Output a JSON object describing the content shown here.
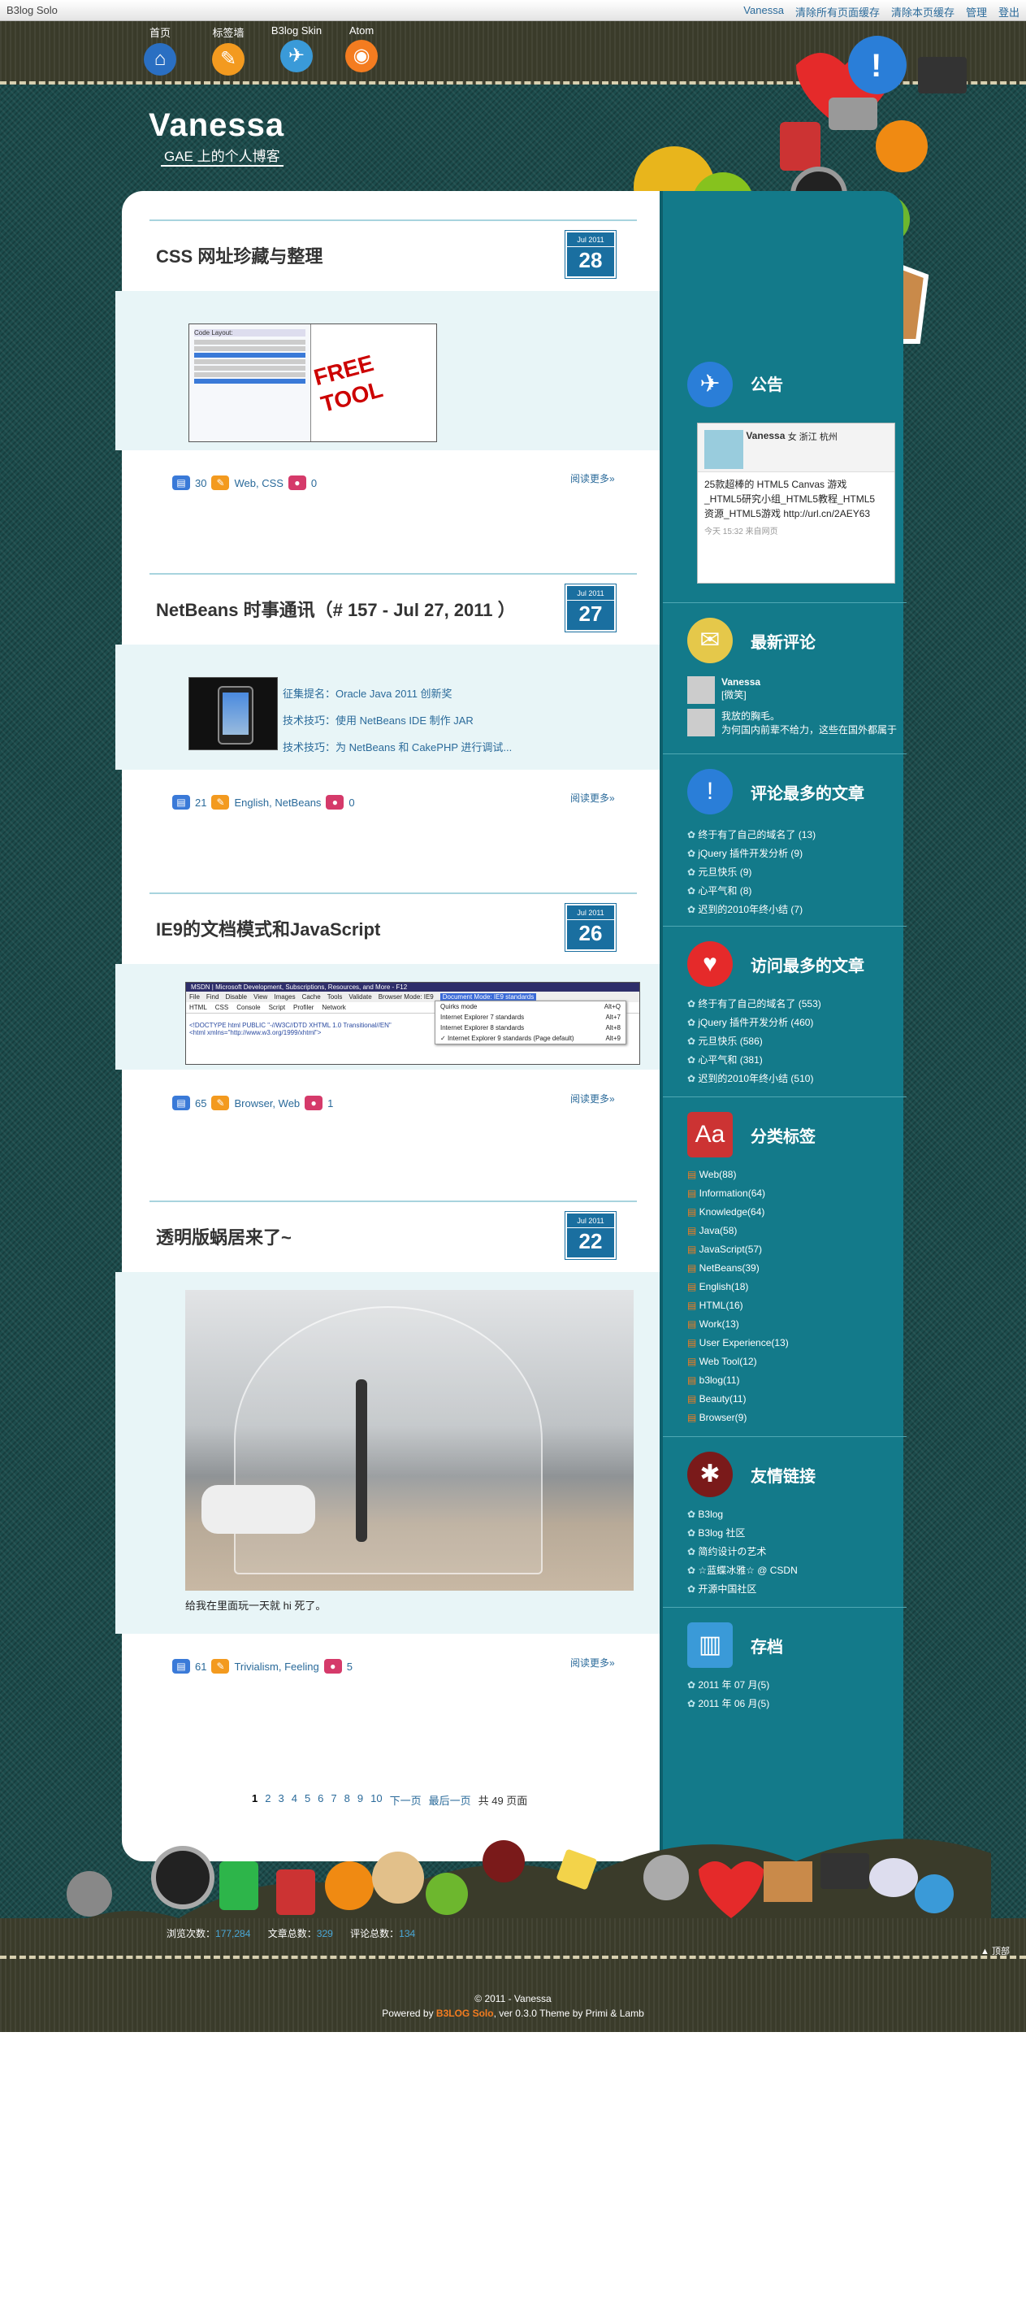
{
  "topbar": {
    "brand": "B3log Solo",
    "user": "Vanessa",
    "clear_all": "清除所有页面缓存",
    "clear_page": "清除本页缓存",
    "admin": "管理",
    "logout": "登出"
  },
  "nav": [
    {
      "label": "首页",
      "icon": "home-icon"
    },
    {
      "label": "标签墙",
      "icon": "tag-icon"
    },
    {
      "label": "B3log Skin",
      "icon": "bird-icon"
    },
    {
      "label": "Atom",
      "icon": "rss-icon"
    }
  ],
  "site": {
    "name": "Vanessa",
    "subtitle": "GAE 上的个人博客"
  },
  "posts": [
    {
      "title": "CSS 网址珍藏与整理",
      "month": "Jul 2011",
      "day": "28",
      "comments": "30",
      "tags": "Web, CSS",
      "views": "0",
      "readmore": "阅读更多»",
      "thumb_text": "FREE TOOL"
    },
    {
      "title": "NetBeans 时事通讯（# 157 - Jul 27, 2011 ）",
      "month": "Jul 2011",
      "day": "27",
      "comments": "21",
      "tags": "English, NetBeans",
      "views": "0",
      "readmore": "阅读更多»",
      "links": [
        "征集提名：Oracle Java 2011 创新奖",
        "技术技巧：使用 NetBeans IDE 制作 JAR",
        "技术技巧：为 NetBeans 和 CakePHP 进行调试..."
      ]
    },
    {
      "title": "IE9的文档模式和JavaScript",
      "month": "Jul 2011",
      "day": "26",
      "comments": "65",
      "tags": "Browser, Web",
      "views": "1",
      "readmore": "阅读更多»",
      "window_title": "MSDN | Microsoft Development, Subscriptions, Resources, and More - F12",
      "menu": [
        "File",
        "Find",
        "Disable",
        "View",
        "Images",
        "Cache",
        "Tools",
        "Validate",
        "Browser Mode: IE9"
      ],
      "doc_mode": "Document Mode: IE9 standards",
      "tabs": [
        "HTML",
        "CSS",
        "Console",
        "Script",
        "Profiler",
        "Network"
      ],
      "modes": [
        {
          "name": "Quirks mode",
          "key": "Alt+Q"
        },
        {
          "name": "Internet Explorer 7 standards",
          "key": "Alt+7"
        },
        {
          "name": "Internet Explorer 8 standards",
          "key": "Alt+8"
        },
        {
          "name": "Internet Explorer 9 standards (Page default)",
          "key": "Alt+9"
        }
      ],
      "code1": "<!DOCTYPE html PUBLIC \"-//W3C//DTD XHTML 1.0 Transitional//EN\"",
      "code2": "<html xmlns=\"http://www.w3.org/1999/xhtml\">"
    },
    {
      "title": "透明版蜗居来了~",
      "month": "Jul 2011",
      "day": "22",
      "comments": "61",
      "tags": "Trivialism, Feeling",
      "views": "5",
      "readmore": "阅读更多»",
      "caption": "给我在里面玩一天就 hi 死了。"
    }
  ],
  "pager": {
    "pages": [
      "1",
      "2",
      "3",
      "4",
      "5",
      "6",
      "7",
      "8",
      "9",
      "10"
    ],
    "next": "下一页",
    "last": "最后一页",
    "total": "共 49 页面"
  },
  "sidebar": {
    "notice": {
      "title": "公告",
      "name": "Vanessa",
      "meta": "女 浙江 杭州",
      "text": "25款超棒的 HTML5 Canvas 游戏_HTML5研究小组_HTML5教程_HTML5资源_HTML5游戏 http://url.cn/2AEY63",
      "time": "今天 15:32 来自网页"
    },
    "comments": {
      "title": "最新评论",
      "items": [
        {
          "name": "Vanessa",
          "text": "[微笑]"
        },
        {
          "name": "我放的胸毛。",
          "text": "为何国内前辈不给力，这些在国外都属于"
        }
      ]
    },
    "most_commented": {
      "title": "评论最多的文章",
      "items": [
        "终于有了自己的域名了 (13)",
        "jQuery 插件开发分析 (9)",
        "元旦快乐 (9)",
        "心平气和 (8)",
        "迟到的2010年终小结 (7)"
      ]
    },
    "most_viewed": {
      "title": "访问最多的文章",
      "items": [
        "终于有了自己的域名了 (553)",
        "jQuery 插件开发分析 (460)",
        "元旦快乐 (586)",
        "心平气和 (381)",
        "迟到的2010年终小结 (510)"
      ]
    },
    "tags": {
      "title": "分类标签",
      "items": [
        "Web(88)",
        "Information(64)",
        "Knowledge(64)",
        "Java(58)",
        "JavaScript(57)",
        "NetBeans(39)",
        "English(18)",
        "HTML(16)",
        "Work(13)",
        "User Experience(13)",
        "Web Tool(12)",
        "b3log(11)",
        "Beauty(11)",
        "Browser(9)"
      ]
    },
    "links": {
      "title": "友情链接",
      "items": [
        "B3log",
        "B3log 社区",
        "简约设计の艺术",
        "☆蓝蝶冰雅☆ @ CSDN",
        "开源中国社区"
      ]
    },
    "archive": {
      "title": "存档",
      "items": [
        "2011 年 07 月(5)",
        "2011 年 06 月(5)"
      ]
    }
  },
  "stats": {
    "views_label": "浏览次数：",
    "views": "177,284",
    "articles_label": "文章总数：",
    "articles": "329",
    "comments_label": "评论总数：",
    "comments": "134"
  },
  "footer": {
    "copyright": "© 2011 - Vanessa",
    "powered": "Powered by",
    "logo": "B3LOG Solo",
    "version": ", ver 0.3.0 Theme by Primi & Lamb",
    "top": "顶部"
  }
}
